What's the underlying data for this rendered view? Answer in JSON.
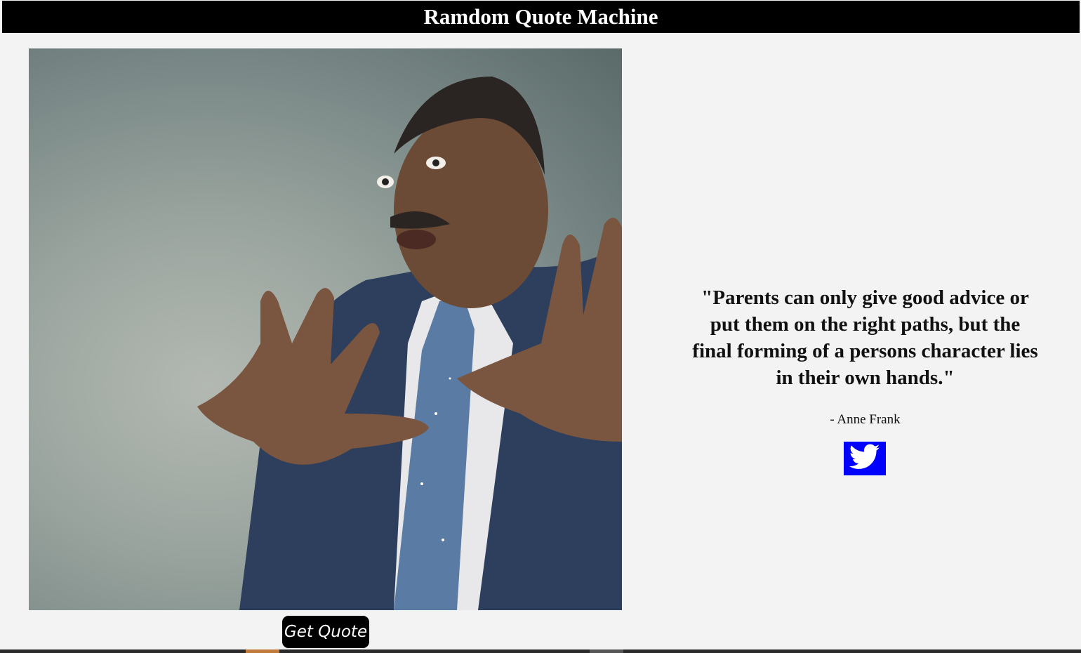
{
  "header": {
    "title": "Ramdom Quote Machine"
  },
  "photo": {
    "alt": "Portrait of a man in a suit with hands raised",
    "background_color": "#8e9a95"
  },
  "buttons": {
    "get_quote_label": "Get Quote"
  },
  "quote": {
    "text": "\"Parents can only give good advice or put them on the right paths, but the final forming of a persons character lies in their own hands.\"",
    "author": "- Anne Frank"
  },
  "share": {
    "icon": "twitter-icon",
    "color": "#0000ff"
  }
}
